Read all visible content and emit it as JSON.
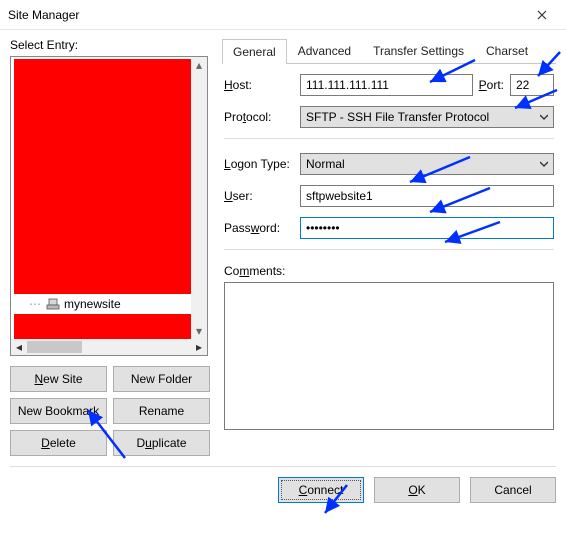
{
  "window": {
    "title": "Site Manager"
  },
  "left": {
    "label": "Select Entry:",
    "site_name": "mynewsite",
    "buttons": {
      "new_site": "New Site",
      "new_folder": "New Folder",
      "new_bookmark": "New Bookmark",
      "rename": "Rename",
      "delete": "Delete",
      "duplicate": "Duplicate"
    }
  },
  "tabs": {
    "general": "General",
    "advanced": "Advanced",
    "transfer": "Transfer Settings",
    "charset": "Charset"
  },
  "form": {
    "host_label": "Host:",
    "host_value": "111.111.111.111",
    "port_label": "Port:",
    "port_value": "22",
    "protocol_label": "Protocol:",
    "protocol_value": "SFTP - SSH File Transfer Protocol",
    "logon_type_label": "Logon Type:",
    "logon_type_value": "Normal",
    "user_label": "User:",
    "user_value": "sftpwebsite1",
    "password_label": "Password:",
    "password_value": "••••••••",
    "comments_label": "Comments:",
    "comments_value": ""
  },
  "footer": {
    "connect": "Connect",
    "ok": "OK",
    "cancel": "Cancel"
  }
}
